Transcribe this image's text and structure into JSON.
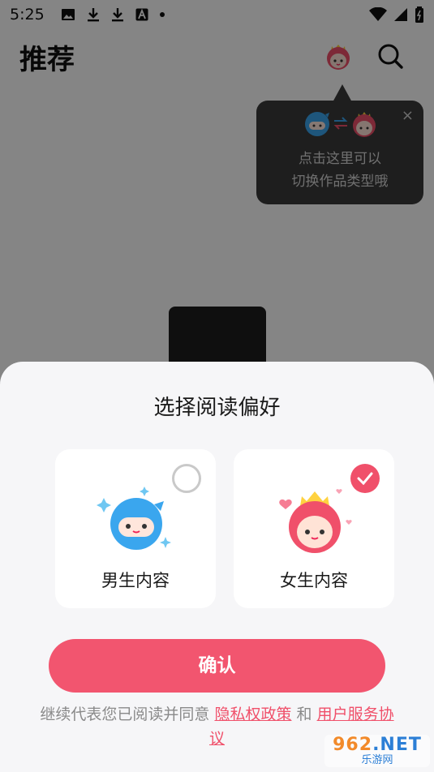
{
  "status_bar": {
    "time": "5:25"
  },
  "header": {
    "title": "推荐"
  },
  "tooltip": {
    "close": "×",
    "line1": "点击这里可以",
    "line2": "切换作品类型哦"
  },
  "sheet": {
    "title": "选择阅读偏好",
    "options": [
      {
        "label": "男生内容",
        "selected": false
      },
      {
        "label": "女生内容",
        "selected": true
      }
    ],
    "confirm_label": "确认",
    "agreement": {
      "prefix": "继续代表您已阅读并同意 ",
      "privacy": "隐私权政策",
      "and": " 和 ",
      "service": "用户服务协议"
    }
  },
  "watermark": {
    "brand_a": "962",
    "brand_b": ".NET",
    "sub": "乐游网"
  },
  "colors": {
    "accent": "#f2556f",
    "male_blue": "#3aa6ee",
    "female_red": "#f0506a"
  }
}
